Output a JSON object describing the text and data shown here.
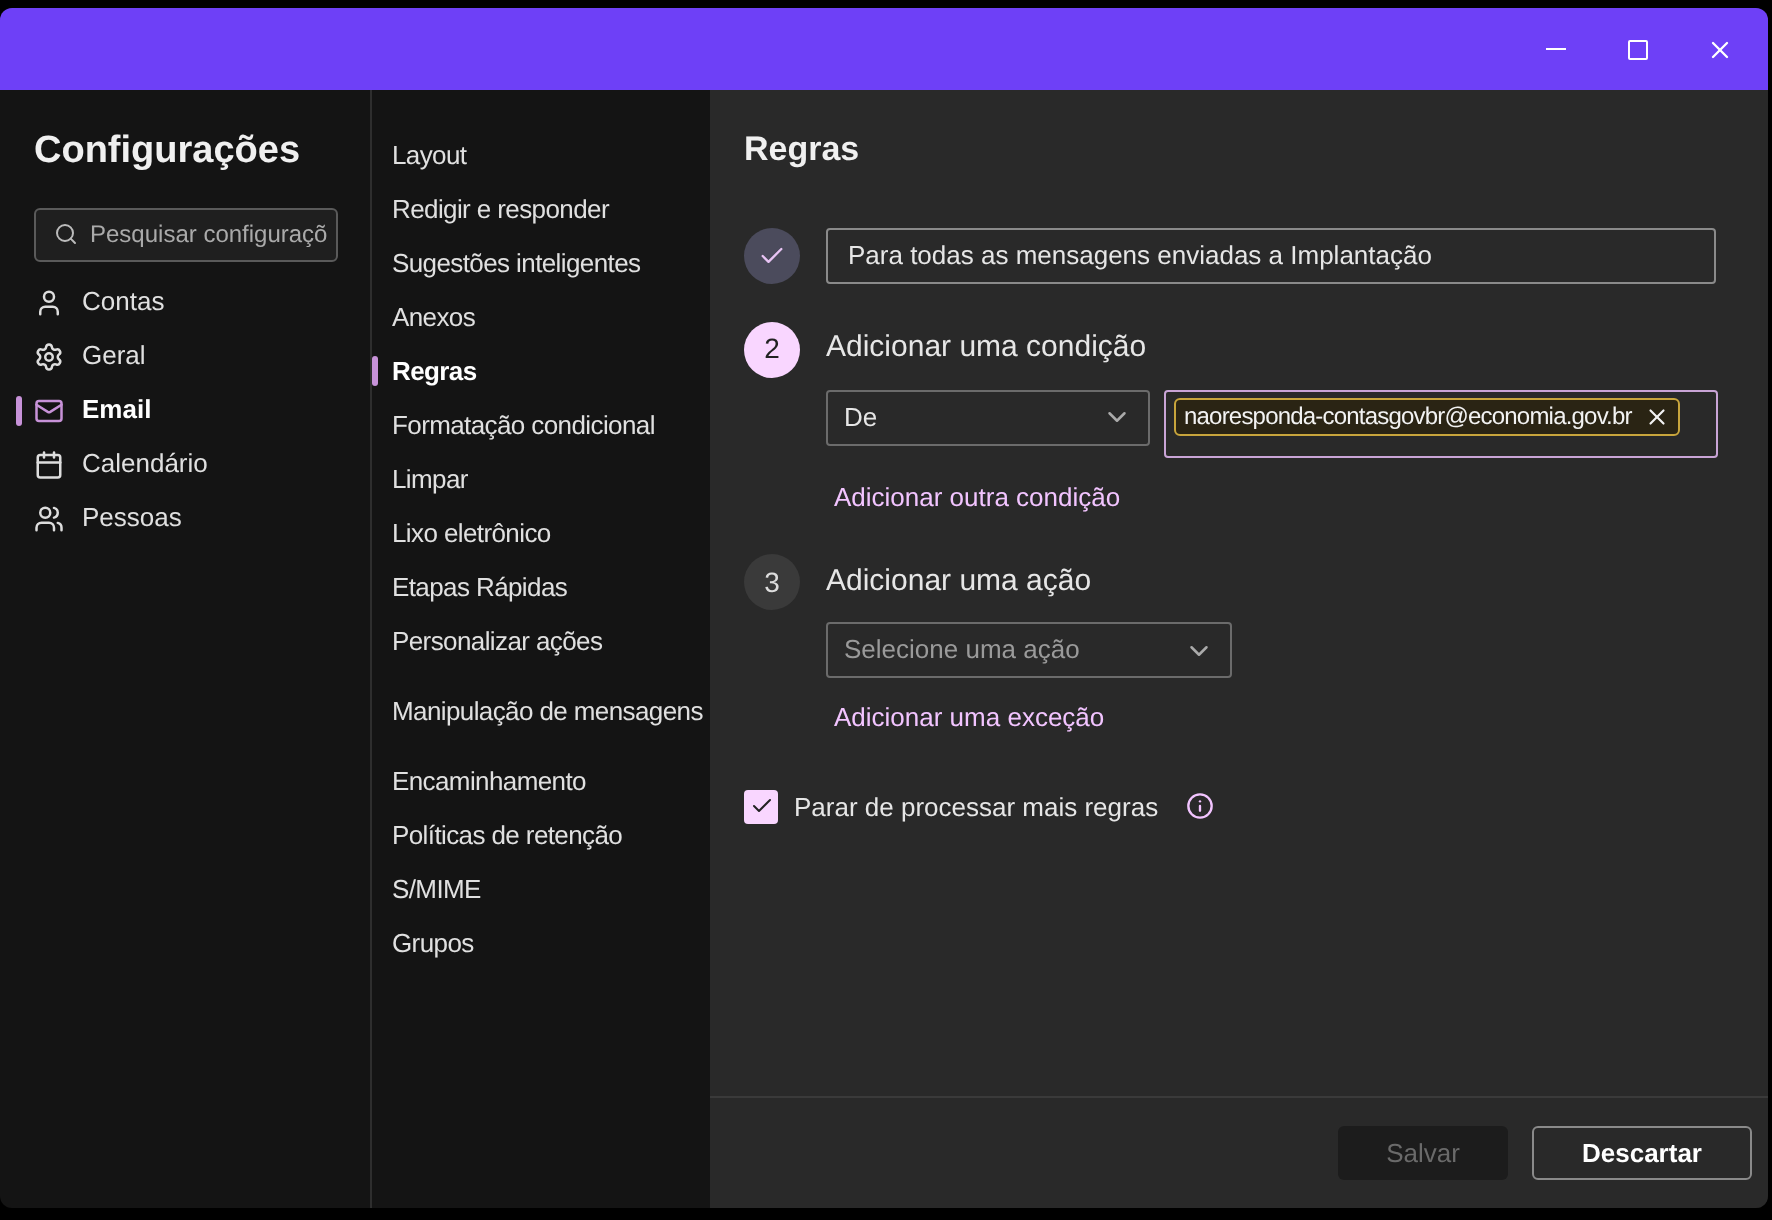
{
  "sidebar": {
    "title": "Configurações",
    "search": {
      "placeholder": "Pesquisar configuraçõ"
    },
    "items": [
      {
        "label": "Contas",
        "selected": false
      },
      {
        "label": "Geral",
        "selected": false
      },
      {
        "label": "Email",
        "selected": true
      },
      {
        "label": "Calendário",
        "selected": false
      },
      {
        "label": "Pessoas",
        "selected": false
      }
    ]
  },
  "menu": {
    "groups": [
      {
        "items": [
          {
            "label": "Layout",
            "selected": false
          },
          {
            "label": "Redigir e responder",
            "selected": false
          },
          {
            "label": "Sugestões inteligentes",
            "selected": false
          },
          {
            "label": "Anexos",
            "selected": false
          },
          {
            "label": "Regras",
            "selected": true
          },
          {
            "label": "Formatação condicional",
            "selected": false
          },
          {
            "label": "Limpar",
            "selected": false
          },
          {
            "label": "Lixo eletrônico",
            "selected": false
          },
          {
            "label": "Etapas Rápidas",
            "selected": false
          },
          {
            "label": "Personalizar ações",
            "selected": false
          }
        ]
      },
      {
        "items": [
          {
            "label": "Manipulação de mensagens",
            "selected": false
          }
        ]
      },
      {
        "items": [
          {
            "label": "Encaminhamento",
            "selected": false
          },
          {
            "label": "Políticas de retenção",
            "selected": false
          },
          {
            "label": "S/MIME",
            "selected": false
          },
          {
            "label": "Grupos",
            "selected": false
          }
        ]
      }
    ]
  },
  "rule": {
    "title": "Regras",
    "steps": [
      {
        "kind": "name",
        "done": true,
        "value": "Para todas as mensagens enviadas a Implantação"
      },
      {
        "kind": "condition",
        "done": false,
        "active": true,
        "number": "2",
        "heading": "Adicionar uma condição",
        "dropdown": "De",
        "chips": [
          "naoresponda-contasgovbr@economia.gov.br"
        ],
        "link": "Adicionar outra condição"
      },
      {
        "kind": "action",
        "done": false,
        "active": false,
        "number": "3",
        "heading": "Adicionar uma ação",
        "placeholder": "Selecione uma ação",
        "link": "Adicionar uma exceção"
      }
    ],
    "stop_processing": {
      "label": "Parar de processar mais regras",
      "checked": true
    }
  },
  "footer": {
    "buttons": [
      {
        "label": "Salvar",
        "kind": "primary",
        "disabled": true
      },
      {
        "label": "Descartar",
        "kind": "secondary",
        "disabled": false
      }
    ]
  }
}
